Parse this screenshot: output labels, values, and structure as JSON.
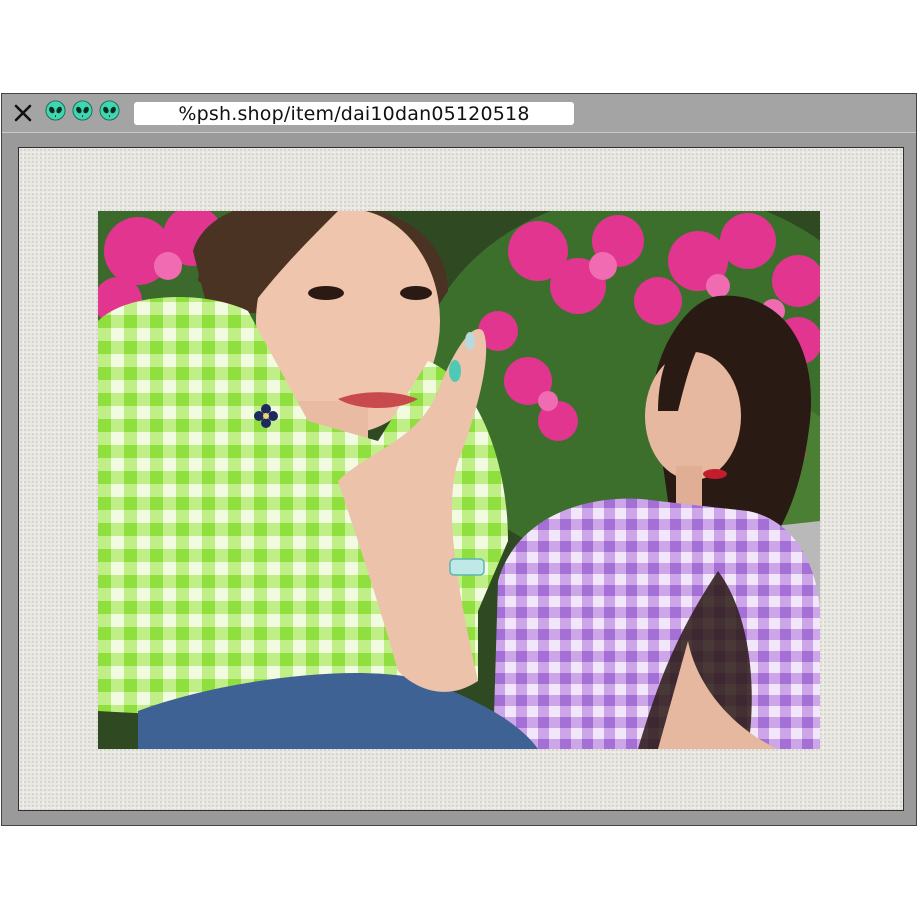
{
  "window": {
    "url": "%psh.shop/item/dai10dan05120518",
    "icons": [
      "close-icon",
      "alien-icon",
      "alien-icon",
      "alien-icon"
    ],
    "colors": {
      "frame": "#a4a4a4",
      "alien_icon": "#3fd6b0",
      "paper": "#e9e7e1"
    }
  },
  "photo": {
    "subject": "photo"
  }
}
